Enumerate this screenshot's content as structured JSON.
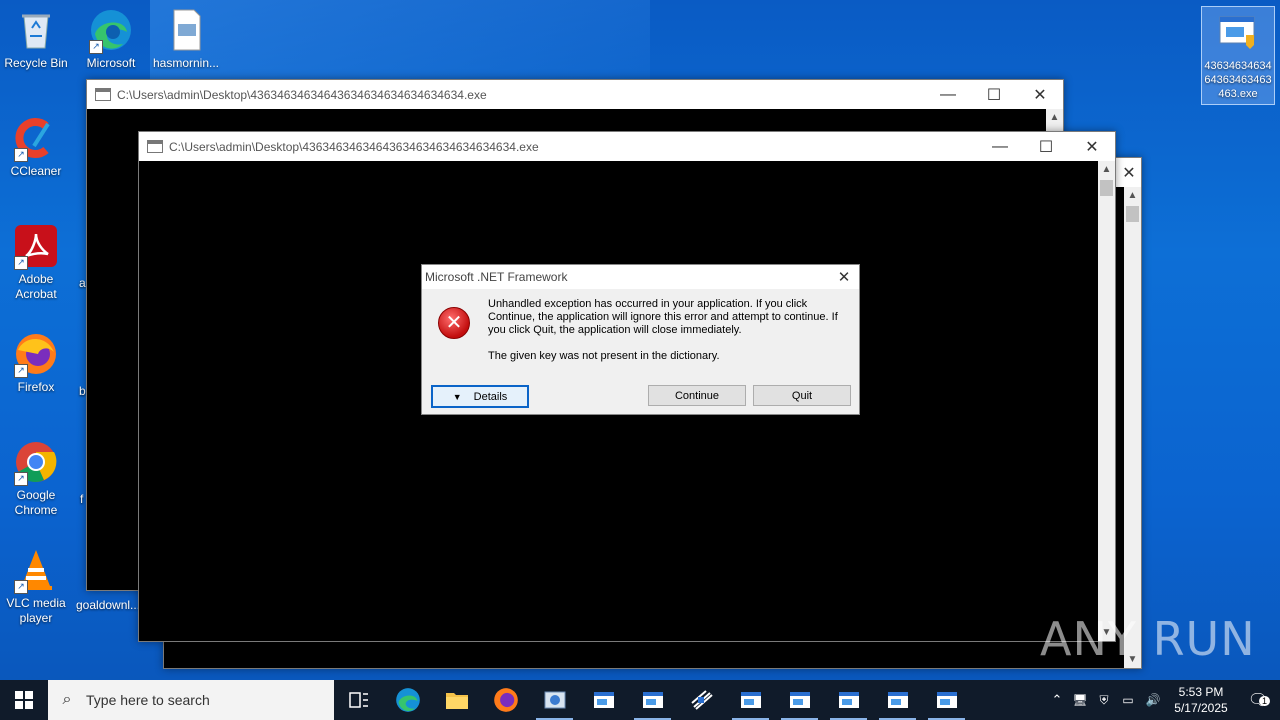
{
  "desktop": {
    "icons": [
      {
        "label": "Recycle Bin"
      },
      {
        "label": "Microsoft Edge"
      },
      {
        "label": "hasmornin..."
      },
      {
        "label": "CCleaner"
      },
      {
        "label": "Adobe Acrobat"
      },
      {
        "label": "Firefox"
      },
      {
        "label": "Google Chrome"
      },
      {
        "label": "VLC media player"
      },
      {
        "label": "goaldownl..."
      },
      {
        "label": "43634634634 64363463463 463.exe"
      }
    ],
    "partial_labels": [
      "a",
      "b",
      "f"
    ]
  },
  "windows": {
    "back_title": "C:\\Users\\admin\\Desktop\\43634634634643634634634634634634.exe",
    "front_title": "C:\\Users\\admin\\Desktop\\43634634634643634634634634634634.exe"
  },
  "dialog": {
    "title": "Microsoft .NET Framework",
    "message1": "Unhandled exception has occurred in your application. If you click Continue, the application will ignore this error and attempt to continue. If you click Quit, the application will close immediately.",
    "message2": "The given key was not present in the dictionary.",
    "details_label": "Details",
    "continue_label": "Continue",
    "quit_label": "Quit"
  },
  "taskbar": {
    "search_placeholder": "Type here to search",
    "time": "5:53 PM",
    "date": "5/17/2025",
    "notification_count": "1"
  },
  "watermark": "ANY RUN"
}
